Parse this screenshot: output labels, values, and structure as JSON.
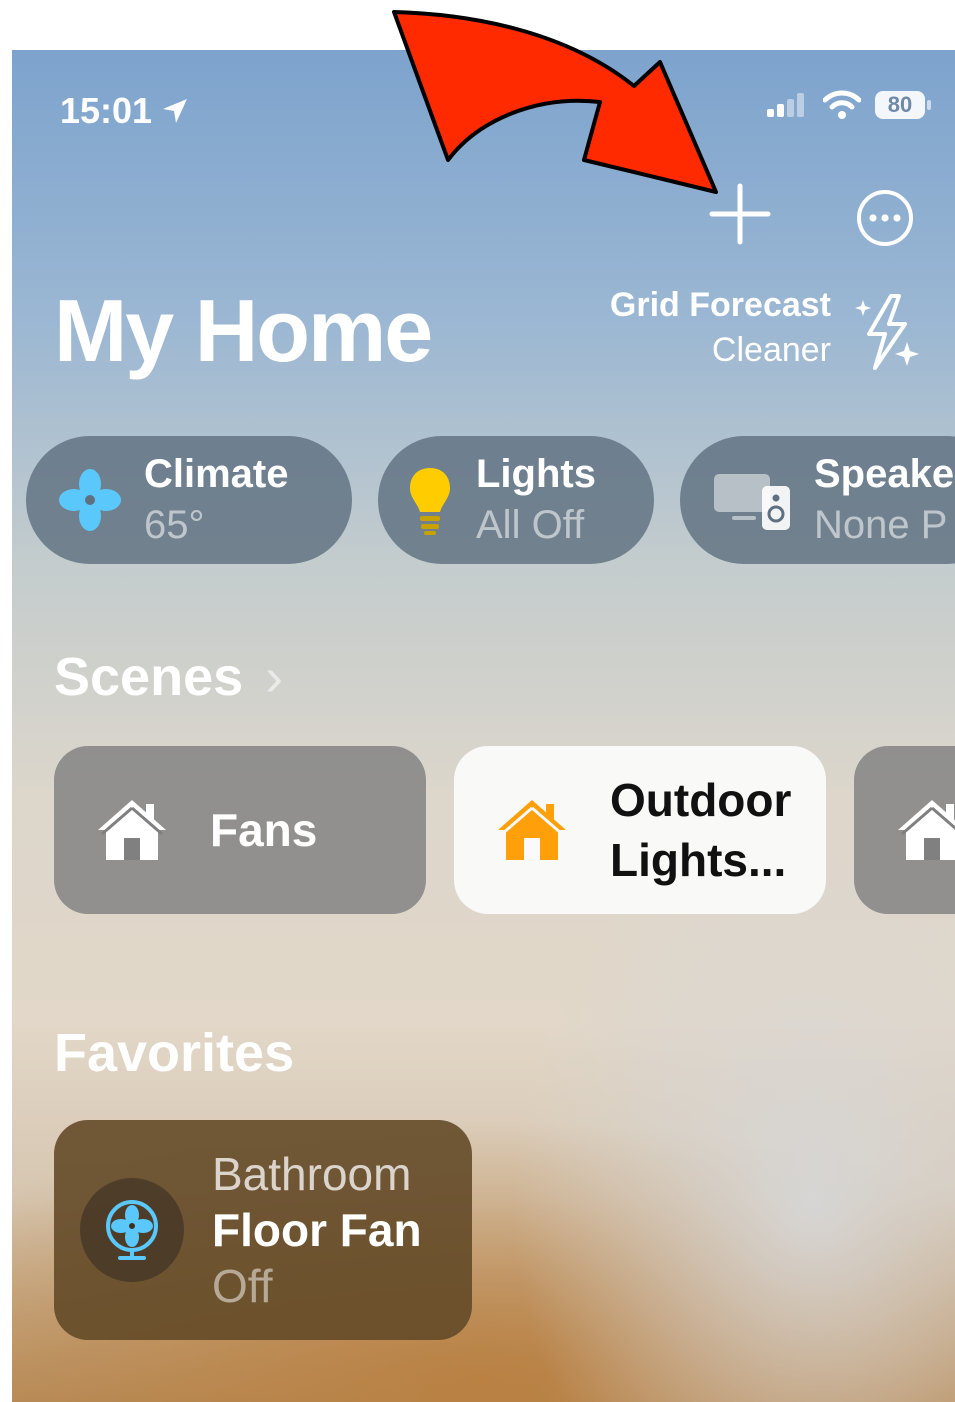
{
  "status_bar": {
    "time": "15:01",
    "battery": "80"
  },
  "header": {
    "title": "My Home",
    "add_icon": "plus-icon",
    "more_icon": "ellipsis-circle-icon"
  },
  "grid_forecast": {
    "label": "Grid Forecast",
    "status": "Cleaner",
    "icon": "sparkle-bolt-icon"
  },
  "categories": [
    {
      "title": "Climate",
      "subtitle": "65°",
      "icon": "fan-icon",
      "color": "#5ac8fa"
    },
    {
      "title": "Lights",
      "subtitle": "All Off",
      "icon": "lightbulb-icon",
      "color": "#ffcc00"
    },
    {
      "title": "Speake",
      "subtitle": "None P",
      "icon": "speaker-icon"
    }
  ],
  "scenes": {
    "heading": "Scenes",
    "items": [
      {
        "label": "Fans",
        "state": "off",
        "icon": "house-icon"
      },
      {
        "label_line1": "Outdoor",
        "label_line2": "Lights...",
        "state": "on",
        "icon": "house-icon",
        "color": "#ff9f0a"
      },
      {
        "label": "",
        "state": "off",
        "icon": "house-icon"
      }
    ]
  },
  "favorites": {
    "heading": "Favorites",
    "items": [
      {
        "room": "Bathroom",
        "name": "Floor Fan",
        "status": "Off",
        "icon": "floor-fan-icon"
      }
    ]
  },
  "colors": {
    "annotation_arrow": "#ff2a00",
    "fan_blue": "#5ac8fa",
    "home_orange": "#ff9f0a"
  }
}
